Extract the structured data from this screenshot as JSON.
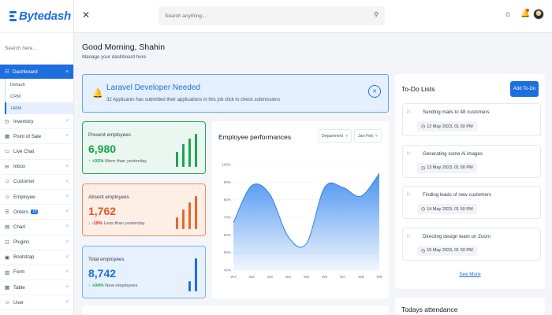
{
  "brand": {
    "name": "Bytedash"
  },
  "sidebar": {
    "search_placeholder": "Search here...",
    "active_section": "Dashboard",
    "dashboard_sub": [
      "Default",
      "CRM",
      "HRM"
    ],
    "active_sub": "HRM",
    "items": [
      {
        "label": "Inventory",
        "icon": "clock-icon",
        "chev": true
      },
      {
        "label": "Point of Sale",
        "icon": "grid-icon",
        "chev": true
      },
      {
        "label": "Live Chat",
        "icon": "chat-icon",
        "chev": false
      },
      {
        "label": "Inbox",
        "icon": "inbox-icon",
        "chev": true
      },
      {
        "label": "Customer",
        "icon": "user-icon",
        "chev": true
      },
      {
        "label": "Employee",
        "icon": "user-icon",
        "chev": true
      },
      {
        "label": "Orders",
        "icon": "cart-icon",
        "chev": true,
        "badge": "10"
      },
      {
        "label": "Chart",
        "icon": "chart-icon",
        "chev": true
      },
      {
        "label": "Plugins",
        "icon": "plug-icon",
        "chev": true
      },
      {
        "label": "Bootstrap",
        "icon": "box-icon",
        "chev": true
      },
      {
        "label": "Form",
        "icon": "form-icon",
        "chev": true
      },
      {
        "label": "Table",
        "icon": "table-icon",
        "chev": true
      },
      {
        "label": "User",
        "icon": "user-icon",
        "chev": true
      }
    ]
  },
  "topbar": {
    "search_placeholder": "Search anything..."
  },
  "greeting": {
    "title": "Good Morning, Shahin",
    "subtitle": "Manage your dashboard here"
  },
  "alert": {
    "title": "Laravel Developer Needed",
    "text": "32 Applicants has submitted their applications in this job click to check submissions"
  },
  "stats": [
    {
      "label": "Present employees",
      "value": "6,980",
      "delta": "+02%",
      "note": "More than yesterday",
      "direction": "up",
      "bars": [
        0.45,
        0.7,
        0.85,
        1.0
      ]
    },
    {
      "label": "Absent employees",
      "value": "1,762",
      "delta": "-19%",
      "note": "Less than yesterday",
      "direction": "down",
      "bars": [
        0.35,
        0.6,
        0.8,
        1.0
      ]
    },
    {
      "label": "Total employees",
      "value": "8,742",
      "delta": "+04%",
      "note": "New employees",
      "direction": "up",
      "bars": [
        0.32,
        1.0
      ]
    }
  ],
  "performance": {
    "title": "Employee performances",
    "filter_department": "Department",
    "filter_range": "Jan-Feb"
  },
  "chart_data": {
    "type": "area",
    "x": [
      "W1",
      "W2",
      "W3",
      "W4",
      "W5",
      "W6",
      "W7",
      "W8",
      "W9"
    ],
    "y_ticks": [
      "40%",
      "50%",
      "60%",
      "70%",
      "80%",
      "90%",
      "100%"
    ],
    "ylim": [
      40,
      100
    ],
    "values": [
      67,
      88,
      83,
      59,
      55,
      87,
      87,
      82,
      95
    ],
    "color": "#4a93f0"
  },
  "todo": {
    "title": "To-Do Lists",
    "add_label": "Add To-Do",
    "see_more": "See More",
    "tasks": [
      {
        "name": "Sending mails to 48 customers",
        "date": "12 May 2023, 01 50 PM"
      },
      {
        "name": "Generating some Ai images",
        "date": "13 May 2023, 01 50 PM"
      },
      {
        "name": "Finding leads of new customers",
        "date": "14 May 2023, 01 50 PM"
      },
      {
        "name": "Directing design team on Zoom",
        "date": "15 May 2023, 01 50 PM"
      }
    ]
  },
  "attendance": {
    "title": "Todays attendance"
  }
}
